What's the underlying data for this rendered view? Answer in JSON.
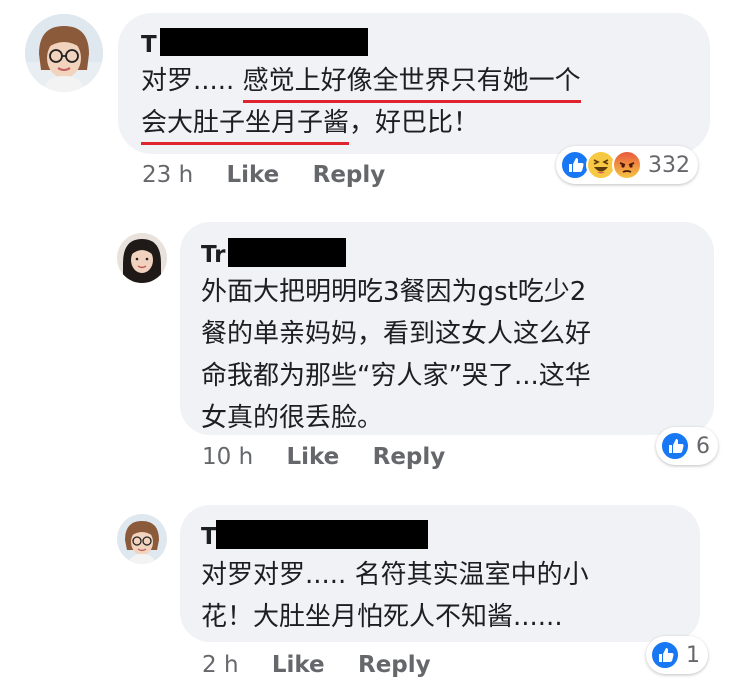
{
  "comments": [
    {
      "author_initial": "T",
      "text_line1_pre": "对罗..... ",
      "text_line1_hl": "感觉上好像全世界只有她一个",
      "text_line2_hl": "会大肚子坐月子酱",
      "text_line2_post": "，好巴比！",
      "time": "23 h",
      "like_label": "Like",
      "reply_label": "Reply",
      "reactions": [
        "like",
        "haha",
        "angry"
      ],
      "reaction_count": "332"
    },
    {
      "author_initial": "Tr",
      "text_lines": [
        "外面大把明明吃3餐因为gst吃少2",
        "餐的单亲妈妈，看到这女人这么好",
        "命我都为那些“穷人家”哭了...这华",
        "女真的很丢脸。"
      ],
      "time": "10 h",
      "like_label": "Like",
      "reply_label": "Reply",
      "reactions": [
        "like"
      ],
      "reaction_count": "6"
    },
    {
      "author_initial": "T",
      "text_lines": [
        "对罗对罗..... 名符其实温室中的小",
        "花！大肚坐月怕死人不知酱......"
      ],
      "time": "2 h",
      "like_label": "Like",
      "reply_label": "Reply",
      "reactions": [
        "like"
      ],
      "reaction_count": "1"
    }
  ],
  "colors": {
    "bubble": "#f0f2f5",
    "like_blue": "#1877f2",
    "underline_red": "#e0242f",
    "meta_gray": "#65676b"
  }
}
